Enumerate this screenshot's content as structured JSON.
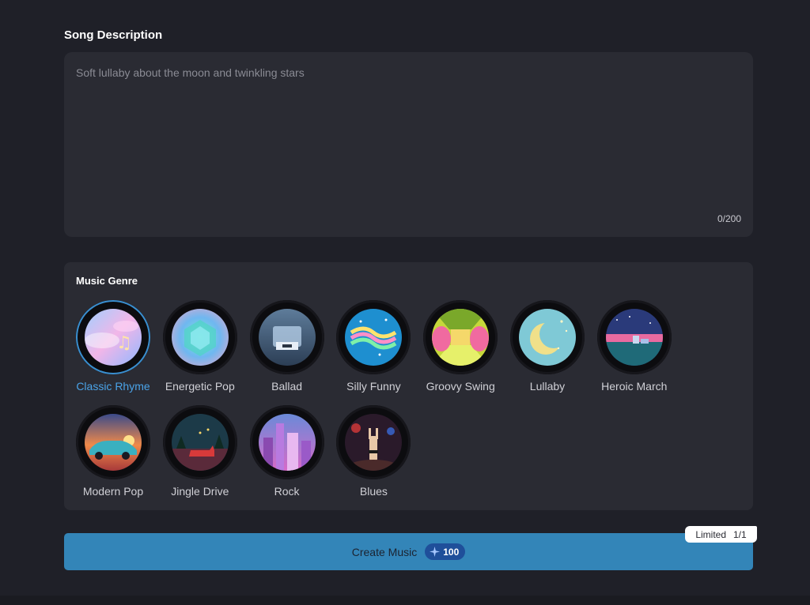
{
  "description": {
    "title": "Song Description",
    "placeholder": "Soft lullaby about the moon and twinkling stars",
    "value": "",
    "char_count": "0/200"
  },
  "genre": {
    "title": "Music Genre",
    "selected": "Classic Rhyme",
    "items": [
      {
        "label": "Classic Rhyme",
        "icon": "pastel-music-note-thumb"
      },
      {
        "label": "Energetic Pop",
        "icon": "holographic-cube-thumb"
      },
      {
        "label": "Ballad",
        "icon": "frosted-window-thumb"
      },
      {
        "label": "Silly Funny",
        "icon": "rainbow-wave-thumb"
      },
      {
        "label": "Groovy Swing",
        "icon": "retro-hallway-thumb"
      },
      {
        "label": "Lullaby",
        "icon": "crescent-moon-thumb"
      },
      {
        "label": "Heroic March",
        "icon": "pixel-castle-thumb"
      },
      {
        "label": "Modern Pop",
        "icon": "classic-car-sunset-thumb"
      },
      {
        "label": "Jingle Drive",
        "icon": "santa-sleigh-thumb"
      },
      {
        "label": "Rock",
        "icon": "neon-city-thumb"
      },
      {
        "label": "Blues",
        "icon": "concert-hand-thumb"
      }
    ]
  },
  "create": {
    "label": "Create Music",
    "credits": "100",
    "icon": "sparkle-icon"
  },
  "badge": {
    "label": "Limited",
    "count": "1/1"
  },
  "colors": {
    "background": "#1f2028",
    "panel": "#2a2b33",
    "accent": "#3385b8",
    "selected_text": "#4aa3e8"
  }
}
